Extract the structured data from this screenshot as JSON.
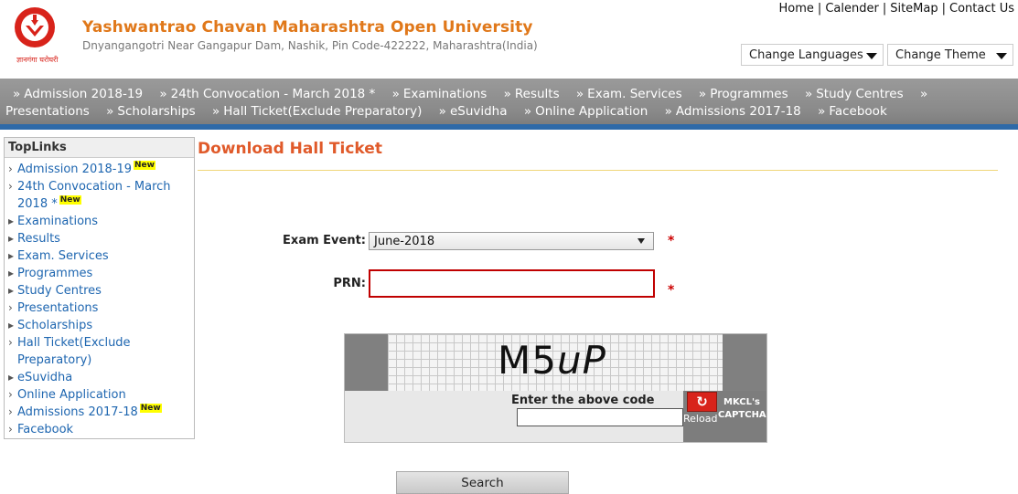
{
  "header": {
    "title": "Yashwantrao Chavan Maharashtra Open University",
    "subtitle": "Dnyangangotri Near Gangapur Dam, Nashik, Pin Code-422222, Maharashtra(India)",
    "logo_caption": "ज्ञानगंगा घरोघरी",
    "top_links": [
      "Home",
      "Calender",
      "SiteMap",
      "Contact Us"
    ],
    "language_select": "Change Languages",
    "theme_select": "Change Theme"
  },
  "menu": {
    "row1": [
      "Admission 2018-19",
      "24th Convocation - March 2018 *",
      "Examinations",
      "Results",
      "Exam. Services",
      "Programmes",
      "Study Centres"
    ],
    "row2": [
      "Presentations",
      "Scholarships",
      "Hall Ticket(Exclude Preparatory)",
      "eSuvidha",
      "Online Application",
      "Admissions 2017-18",
      "Facebook"
    ],
    "arrow": "»"
  },
  "sidebar": {
    "title": "TopLinks",
    "new_label": "New",
    "items": [
      {
        "label": "Admission 2018-19",
        "new": true
      },
      {
        "label": "24th Convocation - March 2018 *",
        "new": true
      },
      {
        "label": "Examinations",
        "new": false
      },
      {
        "label": "Results",
        "new": false
      },
      {
        "label": "Exam. Services",
        "new": false
      },
      {
        "label": "Programmes",
        "new": false
      },
      {
        "label": "Study Centres",
        "new": false
      },
      {
        "label": "Presentations",
        "new": false
      },
      {
        "label": "Scholarships",
        "new": false
      },
      {
        "label": "Hall Ticket(Exclude Preparatory)",
        "new": false
      },
      {
        "label": "eSuvidha",
        "new": false
      },
      {
        "label": "Online Application",
        "new": false
      },
      {
        "label": "Admissions 2017-18",
        "new": true
      },
      {
        "label": "Facebook",
        "new": false
      }
    ]
  },
  "main": {
    "title": "Download Hall Ticket",
    "exam_event_label": "Exam Event:",
    "exam_event_value": "June-2018",
    "prn_label": "PRN:",
    "prn_value": "",
    "required_mark": "*",
    "captcha": {
      "code_prefix": "M5",
      "code_italic": "uP",
      "prompt": "Enter the above code",
      "reload_label": "Reload",
      "reload_icon": "↻",
      "brand": "MKCL's CAPTCHA"
    },
    "search_button": "Search"
  }
}
